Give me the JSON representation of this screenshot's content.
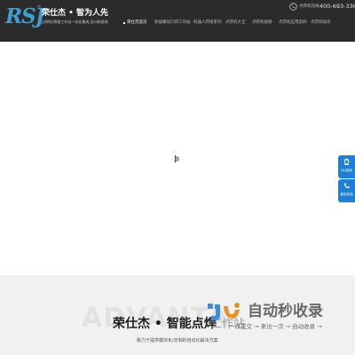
{
  "header": {
    "logo_text": "RSJ",
    "logo_reg": "®",
    "brand_title": "荣仕杰 • 智为人先",
    "brand_subtitle": "点焊机/焊接工作站一站化集成,设计制造商",
    "phone_label": "点焊机热线:",
    "phone_number": "400-693-3363",
    "nav": [
      {
        "label": "荣仕杰首页",
        "active": true
      },
      {
        "label": "智能螺母凸焊工作站",
        "active": false
      },
      {
        "label": "机器人焊接系列",
        "active": false
      },
      {
        "label": "点焊机大全",
        "active": false
      },
      {
        "label": "点焊机视频",
        "active": false
      },
      {
        "label": "点焊机应用案例",
        "active": false
      },
      {
        "label": "点焊机知识",
        "active": false
      }
    ]
  },
  "side_buttons": [
    {
      "label": "QQ咨询",
      "icon": "qq-icon"
    },
    {
      "label": "服务热线",
      "icon": "phone-icon"
    }
  ],
  "footer": {
    "watermark_bg": "ADVANTA",
    "hero_title": "荣仕杰 • 智能点焊",
    "hero_title_tail": "工作站",
    "hero_subtitle": "致力于提供模块化/定制的自动化解决方案"
  },
  "overlay_watermark": {
    "text": "自动秒收录",
    "slogan": "一次提交 → 来访一次 → 自动收录 →"
  },
  "colors": {
    "topbar": "#2b2b2b",
    "accent_blue": "#1f7fd6",
    "logo": "#3fa0d0"
  }
}
